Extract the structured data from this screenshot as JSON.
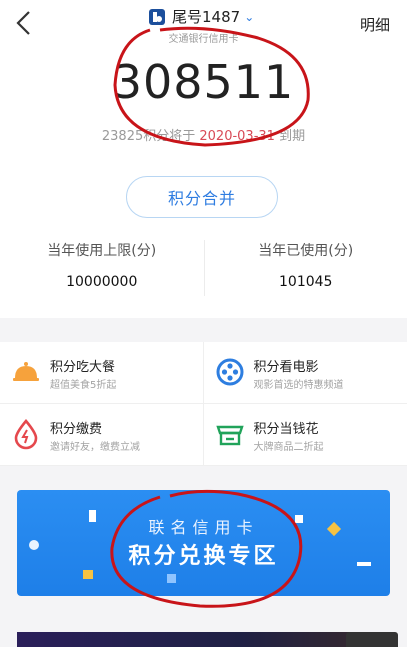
{
  "header": {
    "back_icon": "chevron-left-icon",
    "card_name": "尾号1487",
    "card_sub": "交通银行信用卡",
    "detail_label": "明细"
  },
  "points": {
    "balance": "308511",
    "expire_prefix": "23825积分将于 ",
    "expire_date": "2020-03-31",
    "expire_suffix": " 到期"
  },
  "merge_button": "积分合并",
  "stats": {
    "limit_label": "当年使用上限(分)",
    "limit_value": "10000000",
    "used_label": "当年已使用(分)",
    "used_value": "101045"
  },
  "services": [
    {
      "title": "积分吃大餐",
      "subtitle": "超值美食5折起",
      "icon": "dining-bell-icon"
    },
    {
      "title": "积分看电影",
      "subtitle": "观影首选的特惠频道",
      "icon": "film-reel-icon"
    },
    {
      "title": "积分缴费",
      "subtitle": "邀请好友，缴费立减",
      "icon": "utility-drop-icon"
    },
    {
      "title": "积分当钱花",
      "subtitle": "大牌商品二折起",
      "icon": "store-icon"
    }
  ],
  "banner": {
    "line1": "联名信用卡",
    "line2": "积分兑换专区"
  },
  "colors": {
    "accent": "#2f7de1",
    "expire_date": "#d84a57",
    "banner": "#2289ee",
    "annotation": "#c81419"
  }
}
